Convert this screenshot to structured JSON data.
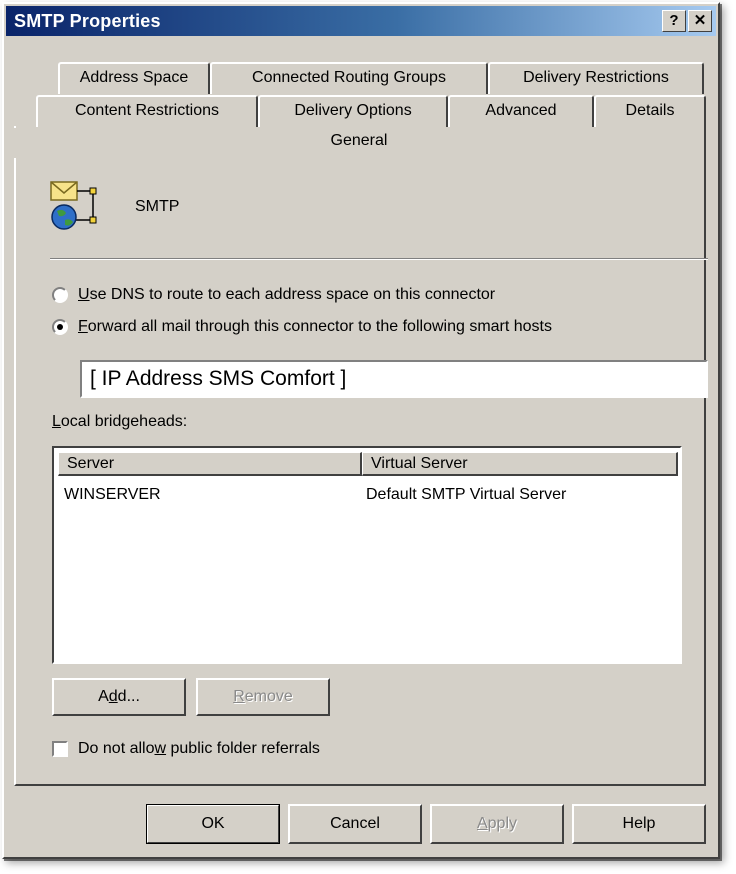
{
  "window": {
    "title": "SMTP Properties",
    "help_glyph": "?",
    "close_glyph": "✕"
  },
  "tabs": {
    "row1": [
      "Address Space",
      "Connected Routing Groups",
      "Delivery Restrictions"
    ],
    "row2": [
      "Content Restrictions",
      "Delivery Options",
      "Advanced",
      "Details"
    ],
    "selected": "General"
  },
  "header": {
    "icon": "connector-icon",
    "name": "SMTP"
  },
  "routing": {
    "option_dns": {
      "mnemonic": "U",
      "rest": "se DNS to route to each address space on this connector",
      "checked": false
    },
    "option_forward": {
      "mnemonic": "F",
      "rest": "orward all mail through this connector to the following smart hosts",
      "checked": true
    },
    "smart_hosts_value": "[ IP Address SMS Comfort ]"
  },
  "bridgeheads": {
    "label_mnemonic": "L",
    "label_rest": "ocal bridgeheads:",
    "columns": [
      "Server",
      "Virtual Server"
    ],
    "rows": [
      {
        "server": "WINSERVER",
        "virtual_server": "Default SMTP Virtual Server"
      }
    ],
    "add_prefix": "A",
    "add_mnemonic": "d",
    "add_suffix": "d...",
    "remove_mnemonic": "R",
    "remove_rest": "emove"
  },
  "public_folder": {
    "prefix": "Do not allo",
    "mnemonic": "w",
    "suffix": " public folder referrals",
    "checked": false
  },
  "footer": {
    "ok": "OK",
    "cancel": "Cancel",
    "apply_mnemonic": "A",
    "apply_rest": "pply",
    "help": "Help"
  },
  "colors": {
    "title_start": "#0a246a",
    "title_end": "#a6caf0",
    "face": "#d4d0c8"
  }
}
